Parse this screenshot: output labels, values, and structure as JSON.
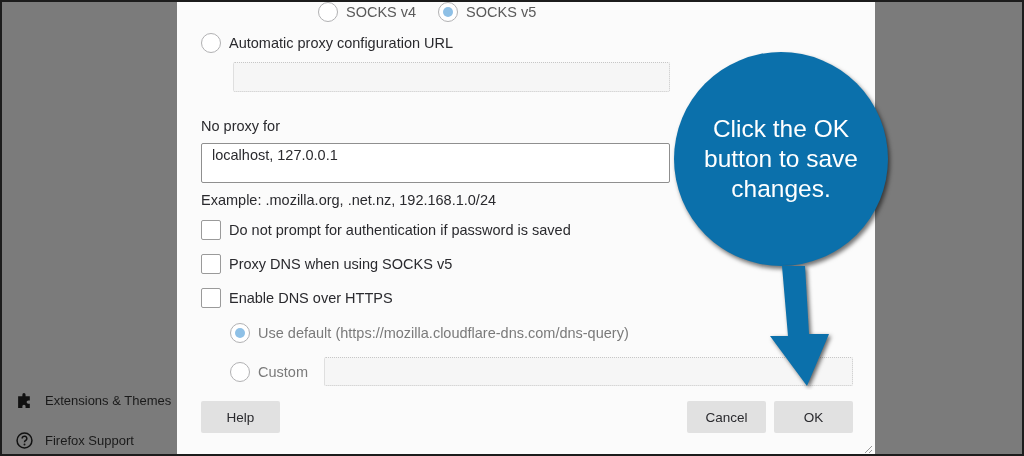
{
  "sidebar": {
    "items": [
      {
        "kind": "extensions",
        "label": "Extensions & Themes"
      },
      {
        "kind": "support",
        "label": "Firefox Support"
      }
    ]
  },
  "dialog": {
    "proxy_version": {
      "options": [
        {
          "label": "SOCKS v4",
          "selected": false
        },
        {
          "label": "SOCKS v5",
          "selected": true
        }
      ]
    },
    "auto_proxy": {
      "label": "Automatic proxy configuration URL",
      "selected": false
    },
    "no_proxy": {
      "label": "No proxy for",
      "value": "localhost, 127.0.0.1",
      "example": "Example: .mozilla.org, .net.nz, 192.168.1.0/24"
    },
    "checkboxes": [
      {
        "label": "Do not prompt for authentication if password is saved",
        "checked": false
      },
      {
        "label": "Proxy DNS when using SOCKS v5",
        "checked": false
      },
      {
        "label": "Enable DNS over HTTPS",
        "checked": false
      }
    ],
    "dns_options": {
      "disabled": true,
      "options": [
        {
          "label": "Use default (https://mozilla.cloudflare-dns.com/dns-query)",
          "selected": true
        },
        {
          "label": "Custom",
          "selected": false
        }
      ]
    },
    "buttons": {
      "help": "Help",
      "cancel": "Cancel",
      "ok": "OK"
    }
  },
  "callout": {
    "text": "Click the OK button to save changes."
  }
}
